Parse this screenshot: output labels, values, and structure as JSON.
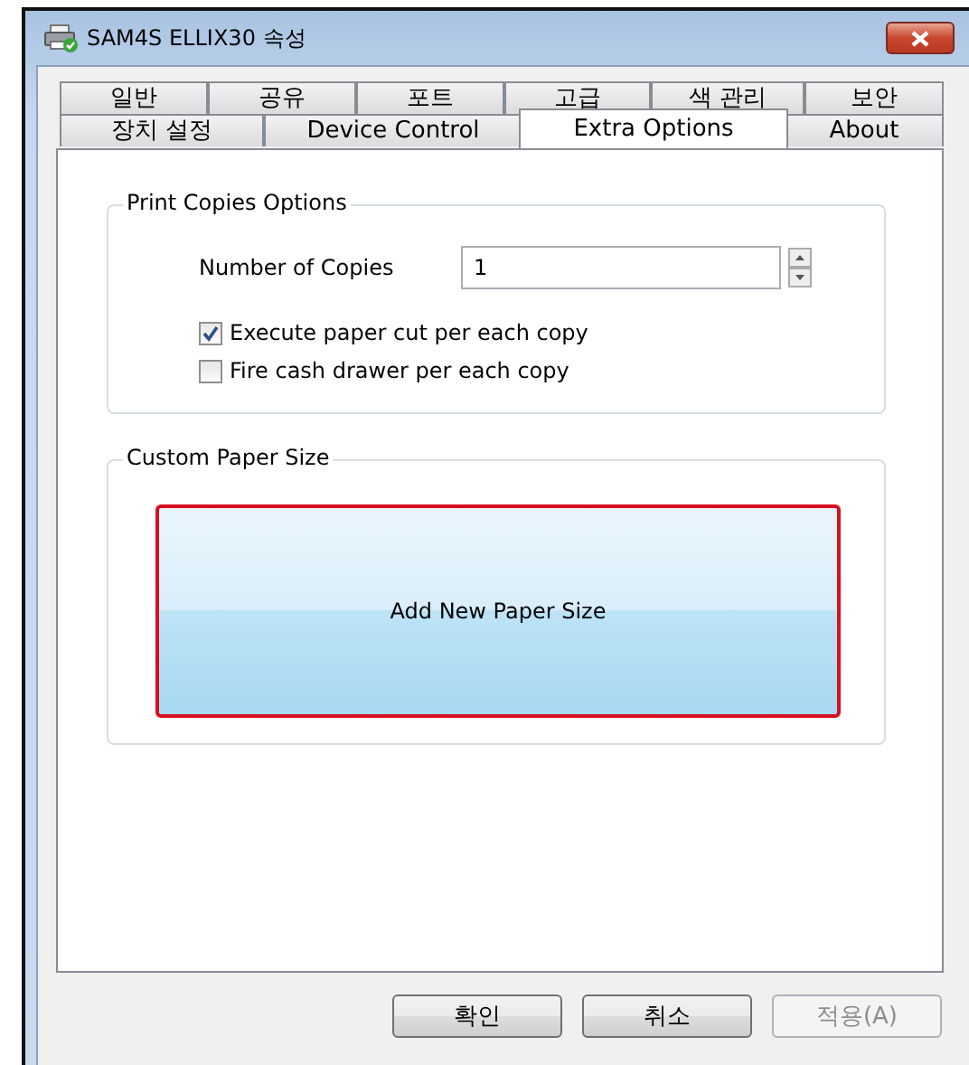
{
  "window": {
    "title": "SAM4S ELLIX30 속성"
  },
  "tab_rows": [
    [
      {
        "label": "일반",
        "selected": false
      },
      {
        "label": "공유",
        "selected": false
      },
      {
        "label": "포트",
        "selected": false
      },
      {
        "label": "고급",
        "selected": false
      },
      {
        "label": "색 관리",
        "selected": false
      },
      {
        "label": "보안",
        "selected": false
      }
    ],
    [
      {
        "label": "장치 설정",
        "selected": false
      },
      {
        "label": "Device Control",
        "selected": false
      },
      {
        "label": "Extra Options",
        "selected": true
      },
      {
        "label": "About",
        "selected": false
      }
    ]
  ],
  "print_copies": {
    "title": "Print Copies Options",
    "copies_label": "Number of Copies",
    "copies_value": "1",
    "checkboxes": [
      {
        "label": "Execute paper cut per each copy",
        "checked": true
      },
      {
        "label": "Fire cash drawer per each copy",
        "checked": false
      }
    ]
  },
  "custom_paper": {
    "title": "Custom Paper Size",
    "button": "Add New Paper Size",
    "highlighted": true
  },
  "buttons": [
    {
      "label": "확인",
      "disabled": false
    },
    {
      "label": "취소",
      "disabled": false
    },
    {
      "label": "적용(A)",
      "disabled": true
    }
  ]
}
